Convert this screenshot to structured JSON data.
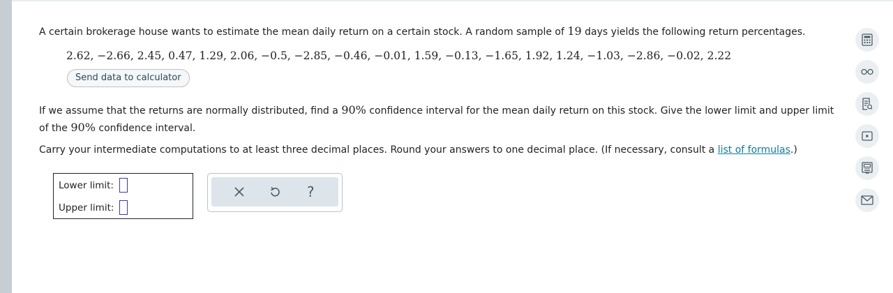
{
  "question": {
    "intro_before": "A certain brokerage house wants to estimate the mean daily return on a certain stock. A random sample of",
    "sample_size": "19",
    "intro_after": "days yields the following return percentages.",
    "dataset": "2.62, −2.66, 2.45, 0.47, 1.29, 2.06, −0.5, −2.85, −0.46, −0.01, 1.59, −0.13, −1.65, 1.92, 1.24, −1.03, −2.86, −0.02, 2.22",
    "send_button_label": "Send data to calculator",
    "body_part1": "If we assume that the returns are normally distributed, find a",
    "confidence": "90%",
    "body_part2": "confidence interval for the mean daily return on this stock. Give the lower limit and upper limit of the",
    "body_part3": "confidence interval.",
    "carry_text": "Carry your intermediate computations to at least three decimal places. Round your answers to one decimal place. (If necessary, consult a",
    "formulas_link": "list of formulas",
    "carry_end": ".)"
  },
  "answer": {
    "lower_label": "Lower limit:",
    "upper_label": "Upper limit:",
    "lower_value": "",
    "upper_value": ""
  },
  "toolbar": {
    "clear_glyph": "×",
    "undo_glyph": "↺",
    "help_glyph": "?"
  },
  "side_tools": [
    {
      "icon": "calculator-icon"
    },
    {
      "icon": "glasses-icon"
    },
    {
      "icon": "notes-icon"
    },
    {
      "icon": "video-icon"
    },
    {
      "icon": "textbook-icon"
    },
    {
      "icon": "mail-icon"
    }
  ],
  "colors": {
    "link": "#147a9e",
    "input_border": "#3a3aa0",
    "sidebar_bg": "#c6ced4",
    "tools_bg": "#dde5ea"
  }
}
